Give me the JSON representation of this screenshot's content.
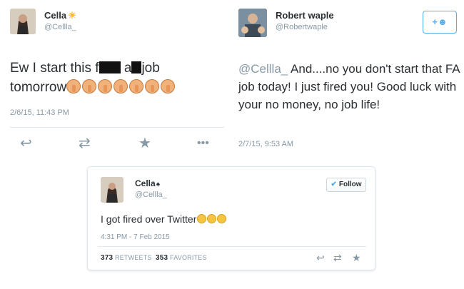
{
  "tweet1": {
    "name": "Cella",
    "handle": "@Cellla_",
    "text_part1": "Ew I start this f",
    "text_part2": "a",
    "text_part3": "job",
    "text_line2": "tomorrow",
    "thumbs_down_count": 7,
    "timestamp": "2/6/15, 11:43 PM",
    "actions": {
      "reply_icon": "reply-icon",
      "retweet_icon": "retweet-icon",
      "favorite_icon": "star-icon",
      "more_icon": "more-icon"
    }
  },
  "tweet2": {
    "name": "Robert waple",
    "handle": "@Robertwaple",
    "mention": "@Cellla_",
    "text": " And....no you don't start that FA job today!  I just fired you! Good luck with your no money, no job life!",
    "timestamp": "2/7/15, 9:53 AM",
    "follow_label": "+☻"
  },
  "card": {
    "name": "Cella",
    "handle": "@Cellla_",
    "follow_label": "Follow",
    "text": "I got fired over Twitter",
    "laugh_count": 3,
    "timestamp": "4:31 PM - 7 Feb 2015",
    "retweets_count": "373",
    "retweets_label": "RETWEETS",
    "favorites_count": "353",
    "favorites_label": "FAVORITES"
  },
  "colors": {
    "accent": "#55acee",
    "muted": "#8899a6",
    "text": "#292f33"
  }
}
